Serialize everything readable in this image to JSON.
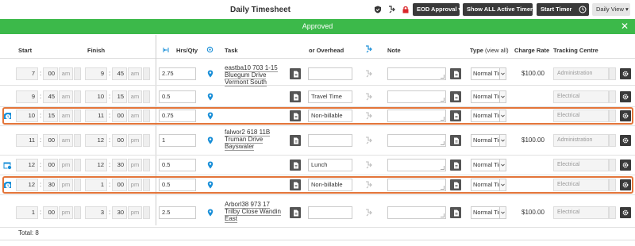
{
  "header": {
    "title": "Daily Timesheet",
    "eod_label": "EOD Approval",
    "active_timers_label": "Show ALL Active Timers (0)",
    "start_timer_label": "Start Timer",
    "daily_view_label": "Daily View"
  },
  "banner": {
    "text": "Approved",
    "close": "✕"
  },
  "columns": {
    "start": "Start",
    "finish": "Finish",
    "hrs": "Hrs/Qty",
    "task": "Task",
    "overhead": "or Overhead",
    "note": "Note",
    "type": "Type",
    "view_all": "(view all)",
    "charge_rate": "Charge Rate",
    "tracking_centre": "Tracking Centre"
  },
  "rows": [
    {
      "sh": "7",
      "sm": "00",
      "sa": "am",
      "fh": "9",
      "fm": "45",
      "fa": "am",
      "hrs": "2.75",
      "task": [
        "eastba10  703  1-15",
        "Bluegum Drive",
        "Vermont South"
      ],
      "overhead": "",
      "type": "Normal Time",
      "rate": "$100.00",
      "tc": "Administration",
      "highlight": false,
      "icon": ""
    },
    {
      "sh": "9",
      "sm": "45",
      "sa": "am",
      "fh": "10",
      "fm": "15",
      "fa": "am",
      "hrs": "0.5",
      "task": [],
      "overhead": "Travel Time",
      "type": "Normal Time",
      "rate": "",
      "tc": "Electrical",
      "highlight": false,
      "icon": ""
    },
    {
      "sh": "10",
      "sm": "15",
      "sa": "am",
      "fh": "11",
      "fm": "00",
      "fa": "am",
      "hrs": "0.75",
      "task": [],
      "overhead": "Non-billable",
      "type": "Normal Time",
      "rate": "",
      "tc": "Electrical",
      "highlight": true,
      "icon": "clock"
    },
    {
      "sh": "11",
      "sm": "00",
      "sa": "am",
      "fh": "12",
      "fm": "00",
      "fa": "pm",
      "hrs": "1",
      "task": [
        "falwor2  618  11B",
        "Truman Drive",
        "Bayswater"
      ],
      "overhead": "",
      "type": "Normal Time",
      "rate": "$100.00",
      "tc": "Administration",
      "highlight": false,
      "icon": ""
    },
    {
      "sh": "12",
      "sm": "00",
      "sa": "pm",
      "fh": "12",
      "fm": "30",
      "fa": "pm",
      "hrs": "0.5",
      "task": [],
      "overhead": "Lunch",
      "type": "Normal Time",
      "rate": "",
      "tc": "Electrical",
      "highlight": false,
      "icon": "calendar"
    },
    {
      "sh": "12",
      "sm": "30",
      "sa": "pm",
      "fh": "1",
      "fm": "00",
      "fa": "pm",
      "hrs": "0.5",
      "task": [],
      "overhead": "Non-billable",
      "type": "Normal Time",
      "rate": "",
      "tc": "Electrical",
      "highlight": true,
      "icon": "clock"
    },
    {
      "sh": "1",
      "sm": "00",
      "sa": "pm",
      "fh": "3",
      "fm": "30",
      "fa": "pm",
      "hrs": "2.5",
      "task": [
        "Arborl38  973  17",
        "Trilby Close Wandin",
        "East"
      ],
      "overhead": "",
      "type": "Normal Time",
      "rate": "$100.00",
      "tc": "Electrical",
      "highlight": false,
      "icon": ""
    }
  ],
  "footer": {
    "total": "Total: 8"
  },
  "colors": {
    "accent": "#3cb94a",
    "highlight": "#e3753a",
    "pin": "#1a8fd8"
  }
}
